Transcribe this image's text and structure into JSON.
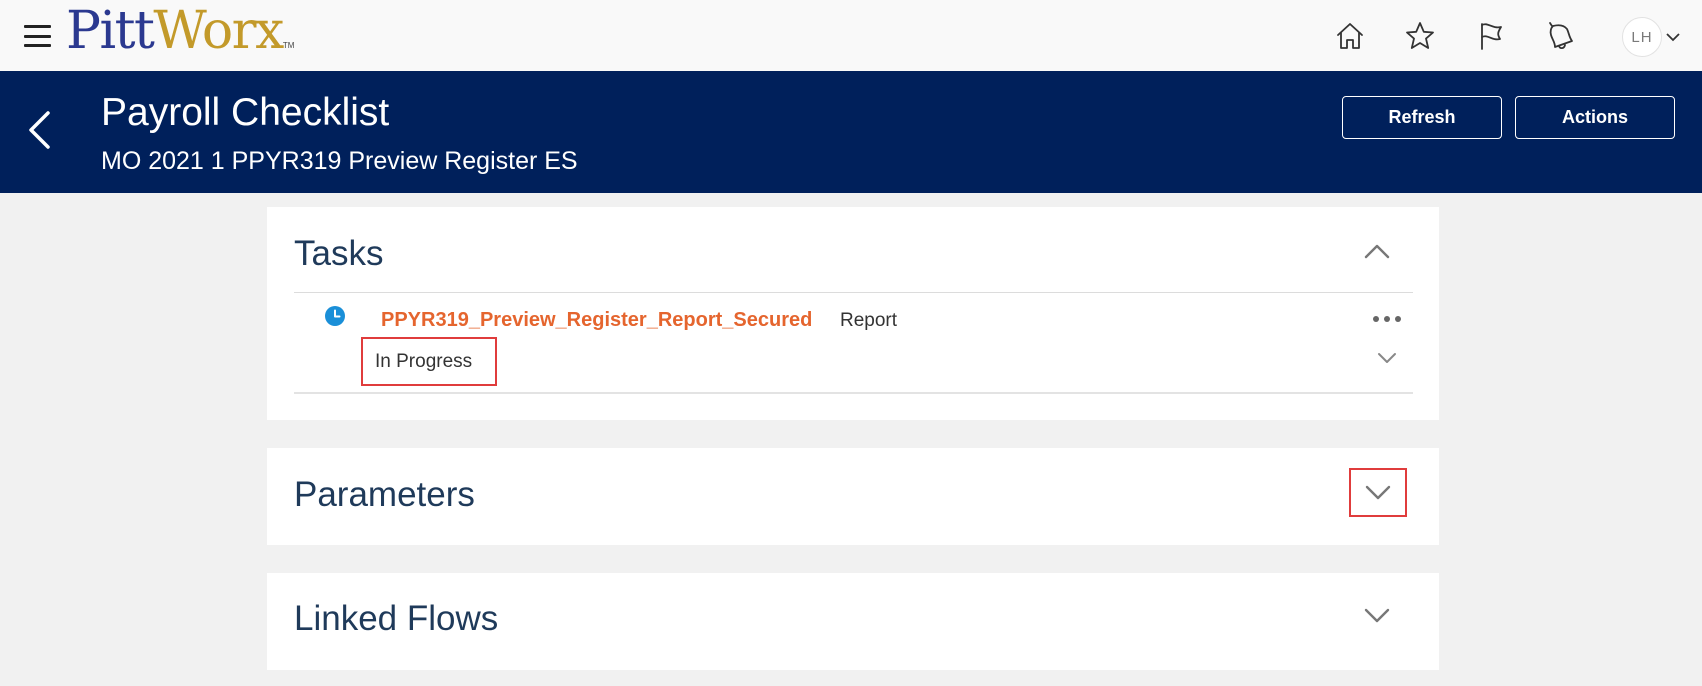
{
  "topbar": {
    "logo_pitt": "Pitt",
    "logo_worx": "Worx",
    "logo_tm": "TM",
    "avatar_initials": "LH"
  },
  "header": {
    "title": "Payroll Checklist",
    "subtitle": "MO 2021 1 PPYR319 Preview Register ES",
    "refresh_label": "Refresh",
    "actions_label": "Actions"
  },
  "tasks": {
    "title": "Tasks",
    "items": [
      {
        "name": "PPYR319_Preview_Register_Report_Secured",
        "type": "Report",
        "status": "In Progress"
      }
    ]
  },
  "parameters": {
    "title": "Parameters"
  },
  "linked_flows": {
    "title": "Linked Flows"
  },
  "colors": {
    "header_bg": "#00205b",
    "task_link": "#e5652e",
    "status_icon": "#1a8fd8",
    "highlight": "#e03c3c",
    "logo_blue": "#2b3990",
    "logo_gold": "#c39a2a"
  }
}
